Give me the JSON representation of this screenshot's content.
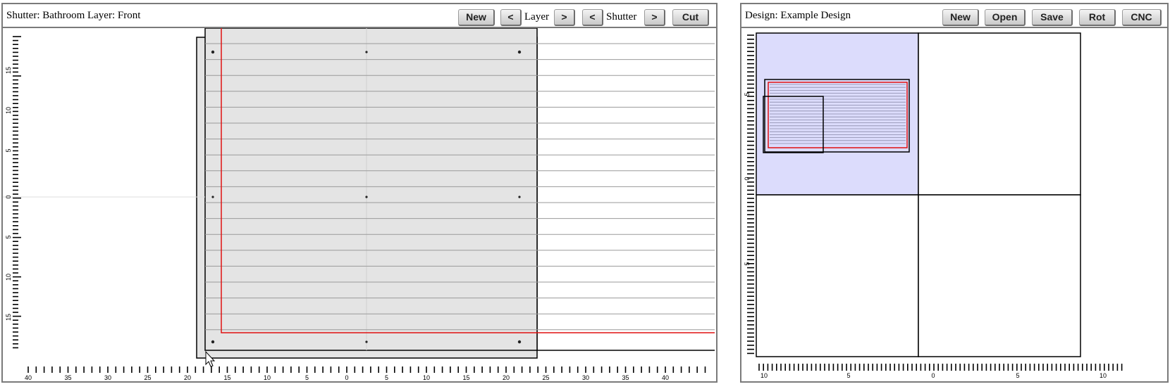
{
  "left": {
    "title": "Shutter: Bathroom Layer: Front",
    "buttons": {
      "new": "New",
      "layer_prev": "<",
      "layer_label": "Layer",
      "layer_next": ">",
      "shutter_prev": "<",
      "shutter_label": "Shutter",
      "shutter_next": ">",
      "cut": "Cut"
    },
    "x_ticks": [
      "40",
      "35",
      "30",
      "25",
      "20",
      "15",
      "10",
      "5",
      "0",
      "5",
      "10",
      "15",
      "20",
      "25",
      "30",
      "35",
      "40"
    ],
    "y_ticks": [
      "15",
      "10",
      "5",
      "0",
      "5",
      "10",
      "15"
    ]
  },
  "right": {
    "title": "Design: Example Design",
    "buttons": {
      "new": "New",
      "open": "Open",
      "save": "Save",
      "rot": "Rot",
      "cnc": "CNC"
    },
    "x_ticks": [
      "10",
      "5",
      "0",
      "5",
      "10"
    ],
    "y_ticks": [
      "5",
      "0",
      "5"
    ]
  },
  "colors": {
    "panel_fill": "#e4e4e4",
    "selected_quadrant": "#dcdcfc",
    "cut_line": "#e01010",
    "slat_line": "#999999"
  }
}
